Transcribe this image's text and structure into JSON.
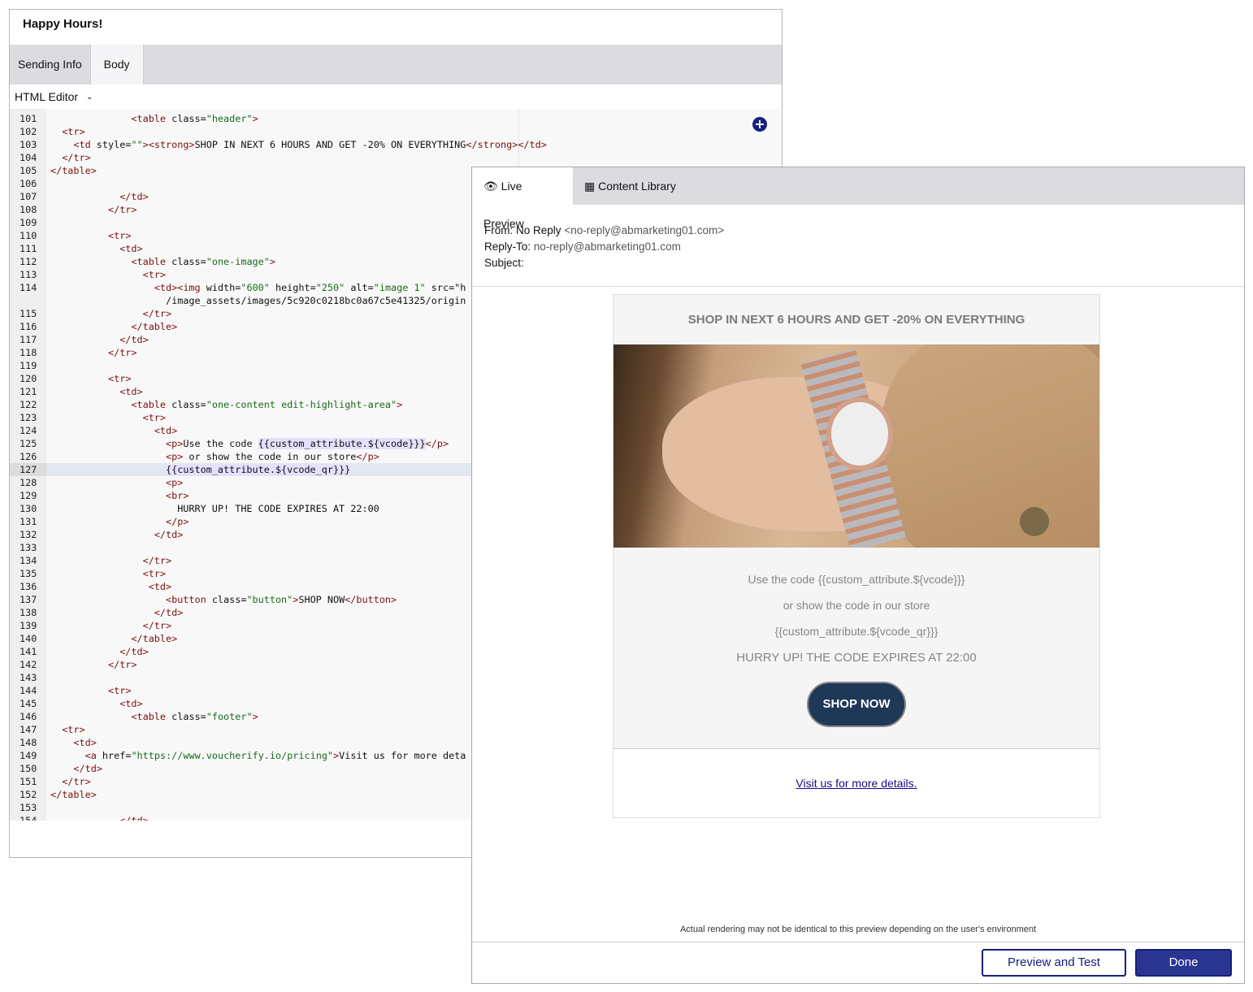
{
  "editor": {
    "title": "Happy Hours!",
    "tabs": [
      {
        "label": "Sending Info"
      },
      {
        "label": "Body"
      }
    ],
    "active_tab": "Body",
    "mode": "HTML Editor",
    "current_line": 127,
    "lines": [
      {
        "n": "101",
        "i": 7,
        "t": "<table class=\"header\">"
      },
      {
        "n": "102",
        "i": 1,
        "t": "<tr>"
      },
      {
        "n": "103",
        "i": 2,
        "t": "<td style=\"\"><strong>SHOP IN NEXT 6 HOURS AND GET -20% ON EVERYTHING</strong></td>"
      },
      {
        "n": "104",
        "i": 1,
        "t": "</tr>"
      },
      {
        "n": "105",
        "i": 0,
        "t": "</table>"
      },
      {
        "n": "106",
        "i": 0,
        "t": ""
      },
      {
        "n": "107",
        "i": 6,
        "t": "</td>"
      },
      {
        "n": "108",
        "i": 5,
        "t": "</tr>"
      },
      {
        "n": "109",
        "i": 0,
        "t": ""
      },
      {
        "n": "110",
        "i": 5,
        "t": "<tr>"
      },
      {
        "n": "111",
        "i": 6,
        "t": "<td>"
      },
      {
        "n": "112",
        "i": 7,
        "t": "<table class=\"one-image\">"
      },
      {
        "n": "113",
        "i": 8,
        "t": "<tr>"
      },
      {
        "n": "114",
        "i": 9,
        "t": "<td><img width=\"600\" height=\"250\" alt=\"image 1\" src=\"h"
      },
      {
        "n": "",
        "i": 10,
        "t": "/image_assets/images/5c920c0218bc0a67c5e41325/origin"
      },
      {
        "n": "115",
        "i": 8,
        "t": "</tr>"
      },
      {
        "n": "116",
        "i": 7,
        "t": "</table>"
      },
      {
        "n": "117",
        "i": 6,
        "t": "</td>"
      },
      {
        "n": "118",
        "i": 5,
        "t": "</tr>"
      },
      {
        "n": "119",
        "i": 0,
        "t": ""
      },
      {
        "n": "120",
        "i": 5,
        "t": "<tr>"
      },
      {
        "n": "121",
        "i": 6,
        "t": "<td>"
      },
      {
        "n": "122",
        "i": 7,
        "t": "<table class=\"one-content edit-highlight-area\">"
      },
      {
        "n": "123",
        "i": 8,
        "t": "<tr>"
      },
      {
        "n": "124",
        "i": 9,
        "t": "<td>"
      },
      {
        "n": "125",
        "i": 10,
        "t": "<p>Use the code {{custom_attribute.${vcode}}}</p>"
      },
      {
        "n": "126",
        "i": 10,
        "t": "<p> or show the code in our store</p>"
      },
      {
        "n": "127",
        "i": 10,
        "t": "{{custom_attribute.${vcode_qr}}}"
      },
      {
        "n": "128",
        "i": 10,
        "t": "<p>"
      },
      {
        "n": "129",
        "i": 10,
        "t": "<br>"
      },
      {
        "n": "130",
        "i": 11,
        "t": "HURRY UP! THE CODE EXPIRES AT 22:00"
      },
      {
        "n": "131",
        "i": 10,
        "t": "</p>"
      },
      {
        "n": "132",
        "i": 9,
        "t": "</td>"
      },
      {
        "n": "133",
        "i": 0,
        "t": ""
      },
      {
        "n": "134",
        "i": 8,
        "t": "</tr>"
      },
      {
        "n": "135",
        "i": 8,
        "t": "<tr>"
      },
      {
        "n": "136",
        "i": 8,
        "t": " <td>"
      },
      {
        "n": "137",
        "i": 10,
        "t": "<button class=\"button\">SHOP NOW</button>"
      },
      {
        "n": "138",
        "i": 9,
        "t": "</td>"
      },
      {
        "n": "139",
        "i": 8,
        "t": "</tr>"
      },
      {
        "n": "140",
        "i": 7,
        "t": "</table>"
      },
      {
        "n": "141",
        "i": 6,
        "t": "</td>"
      },
      {
        "n": "142",
        "i": 5,
        "t": "</tr>"
      },
      {
        "n": "143",
        "i": 0,
        "t": ""
      },
      {
        "n": "144",
        "i": 5,
        "t": "<tr>"
      },
      {
        "n": "145",
        "i": 6,
        "t": "<td>"
      },
      {
        "n": "146",
        "i": 7,
        "t": "<table class=\"footer\">"
      },
      {
        "n": "147",
        "i": 1,
        "t": "<tr>"
      },
      {
        "n": "148",
        "i": 2,
        "t": "<td>"
      },
      {
        "n": "149",
        "i": 3,
        "t": "<a href=\"https://www.voucherify.io/pricing\">Visit us for more deta"
      },
      {
        "n": "150",
        "i": 2,
        "t": "</td>"
      },
      {
        "n": "151",
        "i": 1,
        "t": "</tr>"
      },
      {
        "n": "152",
        "i": 0,
        "t": "</table>"
      },
      {
        "n": "153",
        "i": 0,
        "t": ""
      },
      {
        "n": "154",
        "i": 6,
        "t": "</td>"
      }
    ]
  },
  "preview": {
    "tabs": [
      {
        "label": "Live Preview",
        "icon": "eye-icon"
      },
      {
        "label": "Content Library",
        "icon": "grid-icon"
      }
    ],
    "from_label": "From:",
    "from_name": "No Reply",
    "from_email": "<no-reply@abmarketing01.com>",
    "reply_to_label": "Reply-To:",
    "reply_to": "no-reply@abmarketing01.com",
    "subject_label": "Subject:",
    "email": {
      "headline": "SHOP IN NEXT 6 HOURS AND GET -20% ON EVERYTHING",
      "line1": "Use the code {{custom_attribute.${vcode}}}",
      "line2": "or show the code in our store",
      "line3": "{{custom_attribute.${vcode_qr}}}",
      "hurry": "HURRY UP! THE CODE EXPIRES AT 22:00",
      "button": "SHOP NOW",
      "link": "Visit us for more details."
    },
    "disclaimer": "Actual rendering may not be identical to this preview depending on the user's environment",
    "preview_test_label": "Preview and Test",
    "done_label": "Done"
  },
  "colors": {
    "accent": "#16207a",
    "done_bg": "#2a3592",
    "shop_button": "#1f3858"
  }
}
